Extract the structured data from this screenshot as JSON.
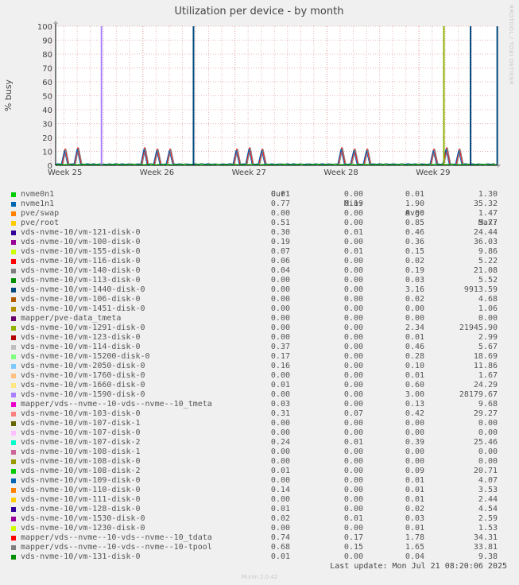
{
  "chart_data": {
    "type": "line",
    "title": "Utilization per device - by month",
    "ylabel": "% busy",
    "ylim": [
      0,
      100
    ],
    "yticks": [
      0,
      10,
      20,
      30,
      40,
      50,
      60,
      70,
      80,
      90,
      100
    ],
    "xticks": [
      "Week 25",
      "Week 26",
      "Week 27",
      "Week 28",
      "Week 29"
    ],
    "grid": true,
    "legend_placement": "bottom",
    "columns": {
      "cur": "Cur:",
      "min": "Min:",
      "avg": "Avg:",
      "max": "Max:"
    },
    "series": [
      {
        "name": "nvme0n1",
        "color": "#00cc00",
        "cur": "0.01",
        "min": "0.00",
        "avg": "0.01",
        "max": "1.30"
      },
      {
        "name": "nvme1n1",
        "color": "#0066b3",
        "cur": "0.77",
        "min": "0.19",
        "avg": "1.90",
        "max": "35.32"
      },
      {
        "name": "pve/swap",
        "color": "#ff8000",
        "cur": "0.00",
        "min": "0.00",
        "avg": "0.00",
        "max": "1.47"
      },
      {
        "name": "pve/root",
        "color": "#ffcc00",
        "cur": "0.51",
        "min": "0.00",
        "avg": "0.85",
        "max": "5.77"
      },
      {
        "name": "vds-nvme-10/vm-121-disk-0",
        "color": "#330099",
        "cur": "0.30",
        "min": "0.01",
        "avg": "0.46",
        "max": "24.44"
      },
      {
        "name": "vds-nvme-10/vm-100-disk-0",
        "color": "#990099",
        "cur": "0.19",
        "min": "0.00",
        "avg": "0.36",
        "max": "36.03"
      },
      {
        "name": "vds-nvme-10/vm-155-disk-0",
        "color": "#ccff00",
        "cur": "0.07",
        "min": "0.01",
        "avg": "0.15",
        "max": "9.86"
      },
      {
        "name": "vds-nvme-10/vm-116-disk-0",
        "color": "#ff0000",
        "cur": "0.06",
        "min": "0.00",
        "avg": "0.02",
        "max": "5.22"
      },
      {
        "name": "vds-nvme-10/vm-140-disk-0",
        "color": "#808080",
        "cur": "0.04",
        "min": "0.00",
        "avg": "0.19",
        "max": "21.08"
      },
      {
        "name": "vds-nvme-10/vm-113-disk-0",
        "color": "#008f00",
        "cur": "0.00",
        "min": "0.00",
        "avg": "0.03",
        "max": "5.52"
      },
      {
        "name": "vds-nvme-10/vm-1440-disk-0",
        "color": "#00487d",
        "cur": "0.00",
        "min": "0.00",
        "avg": "3.16",
        "max": "9913.59"
      },
      {
        "name": "vds-nvme-10/vm-106-disk-0",
        "color": "#b35a00",
        "cur": "0.00",
        "min": "0.00",
        "avg": "0.02",
        "max": "4.68"
      },
      {
        "name": "vds-nvme-10/vm-1451-disk-0",
        "color": "#b38f00",
        "cur": "0.00",
        "min": "0.00",
        "avg": "0.00",
        "max": "1.06"
      },
      {
        "name": "mapper/pve-data_tmeta",
        "color": "#6b006b",
        "cur": "0.00",
        "min": "0.00",
        "avg": "0.00",
        "max": "0.00"
      },
      {
        "name": "vds-nvme-10/vm-1291-disk-0",
        "color": "#8fb300",
        "cur": "0.00",
        "min": "0.00",
        "avg": "2.34",
        "max": "21945.90"
      },
      {
        "name": "vds-nvme-10/vm-123-disk-0",
        "color": "#b30000",
        "cur": "0.00",
        "min": "0.00",
        "avg": "0.01",
        "max": "2.99"
      },
      {
        "name": "vds-nvme-10/vm-114-disk-0",
        "color": "#bebebe",
        "cur": "0.37",
        "min": "0.00",
        "avg": "0.46",
        "max": "5.67"
      },
      {
        "name": "vds-nvme-10/vm-15200-disk-0",
        "color": "#80ff80",
        "cur": "0.17",
        "min": "0.00",
        "avg": "0.28",
        "max": "18.69"
      },
      {
        "name": "vds-nvme-10/vm-2050-disk-0",
        "color": "#80c9ff",
        "cur": "0.16",
        "min": "0.00",
        "avg": "0.10",
        "max": "11.86"
      },
      {
        "name": "vds-nvme-10/vm-1760-disk-0",
        "color": "#ffc080",
        "cur": "0.00",
        "min": "0.00",
        "avg": "0.01",
        "max": "1.67"
      },
      {
        "name": "vds-nvme-10/vm-1660-disk-0",
        "color": "#ffe680",
        "cur": "0.01",
        "min": "0.00",
        "avg": "0.60",
        "max": "24.29"
      },
      {
        "name": "vds-nvme-10/vm-1590-disk-0",
        "color": "#aa80ff",
        "cur": "0.00",
        "min": "0.00",
        "avg": "3.00",
        "max": "28179.67"
      },
      {
        "name": "mapper/vds--nvme--10-vds--nvme--10_tmeta",
        "color": "#ee00cc",
        "cur": "0.03",
        "min": "0.00",
        "avg": "0.13",
        "max": "9.68"
      },
      {
        "name": "vds-nvme-10/vm-103-disk-0",
        "color": "#ff8080",
        "cur": "0.31",
        "min": "0.07",
        "avg": "0.42",
        "max": "29.27"
      },
      {
        "name": "vds-nvme-10/vm-107-disk-1",
        "color": "#666600",
        "cur": "0.00",
        "min": "0.00",
        "avg": "0.00",
        "max": "0.00"
      },
      {
        "name": "vds-nvme-10/vm-107-disk-0",
        "color": "#ffbfff",
        "cur": "0.00",
        "min": "0.00",
        "avg": "0.00",
        "max": "0.00"
      },
      {
        "name": "vds-nvme-10/vm-107-disk-2",
        "color": "#00ffcc",
        "cur": "0.24",
        "min": "0.01",
        "avg": "0.39",
        "max": "25.46"
      },
      {
        "name": "vds-nvme-10/vm-108-disk-1",
        "color": "#cc6699",
        "cur": "0.00",
        "min": "0.00",
        "avg": "0.00",
        "max": "0.00"
      },
      {
        "name": "vds-nvme-10/vm-108-disk-0",
        "color": "#999900",
        "cur": "0.00",
        "min": "0.00",
        "avg": "0.00",
        "max": "0.00"
      },
      {
        "name": "vds-nvme-10/vm-108-disk-2",
        "color": "#00cc00",
        "cur": "0.01",
        "min": "0.00",
        "avg": "0.09",
        "max": "20.71"
      },
      {
        "name": "vds-nvme-10/vm-109-disk-0",
        "color": "#0066b3",
        "cur": "0.00",
        "min": "0.00",
        "avg": "0.01",
        "max": "4.07"
      },
      {
        "name": "vds-nvme-10/vm-110-disk-0",
        "color": "#ff8000",
        "cur": "0.14",
        "min": "0.00",
        "avg": "0.01",
        "max": "3.53"
      },
      {
        "name": "vds-nvme-10/vm-111-disk-0",
        "color": "#ffcc00",
        "cur": "0.00",
        "min": "0.00",
        "avg": "0.01",
        "max": "2.44"
      },
      {
        "name": "vds-nvme-10/vm-128-disk-0",
        "color": "#330099",
        "cur": "0.01",
        "min": "0.00",
        "avg": "0.02",
        "max": "4.54"
      },
      {
        "name": "vds-nvme-10/vm-1530-disk-0",
        "color": "#990099",
        "cur": "0.02",
        "min": "0.01",
        "avg": "0.03",
        "max": "2.59"
      },
      {
        "name": "vds-nvme-10/vm-1230-disk-0",
        "color": "#ccff00",
        "cur": "0.00",
        "min": "0.00",
        "avg": "0.01",
        "max": "1.53"
      },
      {
        "name": "mapper/vds--nvme--10-vds--nvme--10_tdata",
        "color": "#ff0000",
        "cur": "0.74",
        "min": "0.17",
        "avg": "1.78",
        "max": "34.31"
      },
      {
        "name": "mapper/vds--nvme--10-vds--nvme--10-tpool",
        "color": "#808080",
        "cur": "0.68",
        "min": "0.15",
        "avg": "1.65",
        "max": "33.81"
      },
      {
        "name": "vds-nvme-10/vm-131-disk-0",
        "color": "#008f00",
        "cur": "0.01",
        "min": "0.00",
        "avg": "0.04",
        "max": "9.38"
      }
    ],
    "daily_peak_values": [
      12,
      12,
      13,
      13,
      13,
      12,
      13,
      13,
      12,
      12,
      13,
      13,
      12,
      12,
      12,
      13,
      12,
      13,
      13,
      13,
      12,
      13,
      13,
      12,
      12,
      13,
      12,
      12,
      13,
      12,
      13,
      12,
      12
    ],
    "spike_values": [
      {
        "series": "vds-nvme-10/vm-1590-disk-0",
        "color": "#aa80ff",
        "week_pos": 0.55,
        "value": 100
      },
      {
        "series": "vds-nvme-10/vm-1440-disk-0",
        "color": "#00487d",
        "week_pos": 1.55,
        "value": 100
      },
      {
        "series": "vds-nvme-10/vm-1291-disk-0",
        "color": "#8fb300",
        "week_pos": 4.27,
        "value": 100
      },
      {
        "series": "vds-nvme-10/vm-1440-disk-0",
        "color": "#00487d",
        "week_pos": 4.56,
        "value": 100
      },
      {
        "series": "vds-nvme-10/vm-1440-disk-0",
        "color": "#00487d",
        "week_pos": 4.85,
        "value": 100
      }
    ]
  },
  "side_label": "RRDTOOL / TOBI OETIKER",
  "last_update": "Last update: Mon Jul 21 08:20:06 2025",
  "munin_version": "Munin 2.0.42"
}
